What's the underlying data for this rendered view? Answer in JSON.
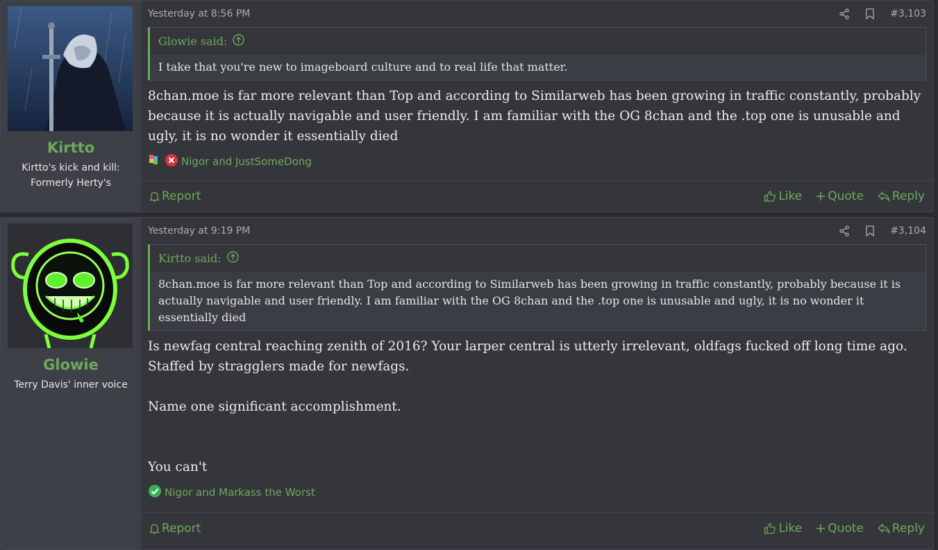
{
  "posts": [
    {
      "username": "Kirtto",
      "user_title": "Kirtto's kick and kill: Formerly Herty's",
      "timestamp": "Yesterday at 8:56 PM",
      "post_number": "#3,103",
      "quote_author": "Glowie said:",
      "quote_text": "I take that you're new to imageboard culture and to real life that matter.",
      "message": "8chan.moe is far more relevant than Top and according to Similarweb has been growing in traffic constantly, probably because it is actually navigable and user friendly. I am familiar with the OG 8chan and the .top one is unusable and ugly, it is no wonder it essentially died",
      "reaction_users": "Nigor and JustSomeDong",
      "reaction_icons": [
        "puzzle-icon",
        "x-circle-icon"
      ]
    },
    {
      "username": "Glowie",
      "user_title": "Terry Davis' inner voice",
      "timestamp": "Yesterday at 9:19 PM",
      "post_number": "#3,104",
      "quote_author": "Kirtto said:",
      "quote_text": "8chan.moe is far more relevant than Top and according to Similarweb has been growing in traffic constantly, probably because it is actually navigable and user friendly. I am familiar with the OG 8chan and the .top one is unusable and ugly, it is no wonder it essentially died",
      "message_lines": [
        "Is newfag central reaching zenith of 2016? Your larper central is utterly irrelevant, oldfags fucked off long time ago. Staffed by stragglers made for newfags.",
        "Name one significant accomplishment.",
        "You can't"
      ],
      "reaction_users": "Nigor and Markass the Worst",
      "reaction_icons": [
        "check-circle-icon"
      ]
    }
  ],
  "actions": {
    "report": "Report",
    "like": "Like",
    "quote": "Quote",
    "reply": "Reply"
  },
  "colors": {
    "accent": "#6fa85a",
    "background": "#2a2c31",
    "post_bg": "#34363c",
    "user_cell_bg": "#3d4047"
  }
}
